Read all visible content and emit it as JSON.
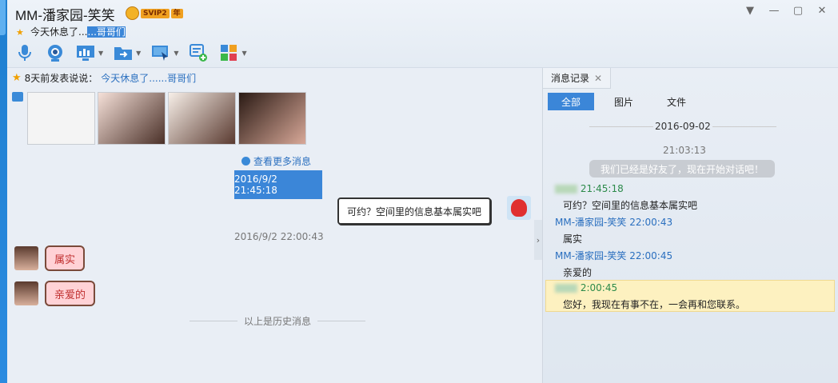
{
  "window": {
    "title": "MM-潘家园-笑笑",
    "vip_label": "SVIP2",
    "vip_year": "年",
    "signature_prefix": "今天休息了...",
    "signature_highlight": "...哥哥们",
    "controls": {
      "menu": "▼",
      "minimize": "—",
      "maximize": "▢",
      "close": "✕"
    }
  },
  "toolbar": {
    "icons": [
      "microphone-icon",
      "webcam-icon",
      "screen-share-icon",
      "file-transfer-icon",
      "remote-assist-icon",
      "add-message-icon",
      "apps-icon"
    ]
  },
  "chat": {
    "story_prefix": "8天前发表说说：",
    "story_link": "今天休息了......哥哥们",
    "view_more": "查看更多消息",
    "selected_timestamp": "2016/9/2 21:45:18",
    "outgoing_message": "可约？空间里的信息基本属实吧",
    "timestamp2": "2016/9/2 22:00:43",
    "incoming": [
      "属实",
      "亲爱的"
    ],
    "history_label": "以上是历史消息"
  },
  "panel": {
    "tab_label": "消息记录",
    "filters": [
      "全部",
      "图片",
      "文件"
    ],
    "date": "2016-09-02",
    "time1": "21:03:13",
    "system_message": "我们已经是好友了，现在开始对话吧！",
    "entries": [
      {
        "sender": "",
        "time": "21:45:18",
        "text": "可约？空间里的信息基本属实吧"
      },
      {
        "sender": "MM-潘家园-笑笑",
        "time": "22:00:43",
        "text": "属实"
      },
      {
        "sender": "MM-潘家园-笑笑",
        "time": "22:00:45",
        "text": "亲爱的"
      },
      {
        "sender": "",
        "time": "2:00:45",
        "text": "您好，我现在有事不在，一会再和您联系。"
      }
    ]
  },
  "colors": {
    "accent": "#3b86d8",
    "link": "#2a6fbf",
    "bubble_in": "#ffd2d6",
    "highlight_row": "#fdf1c0"
  }
}
